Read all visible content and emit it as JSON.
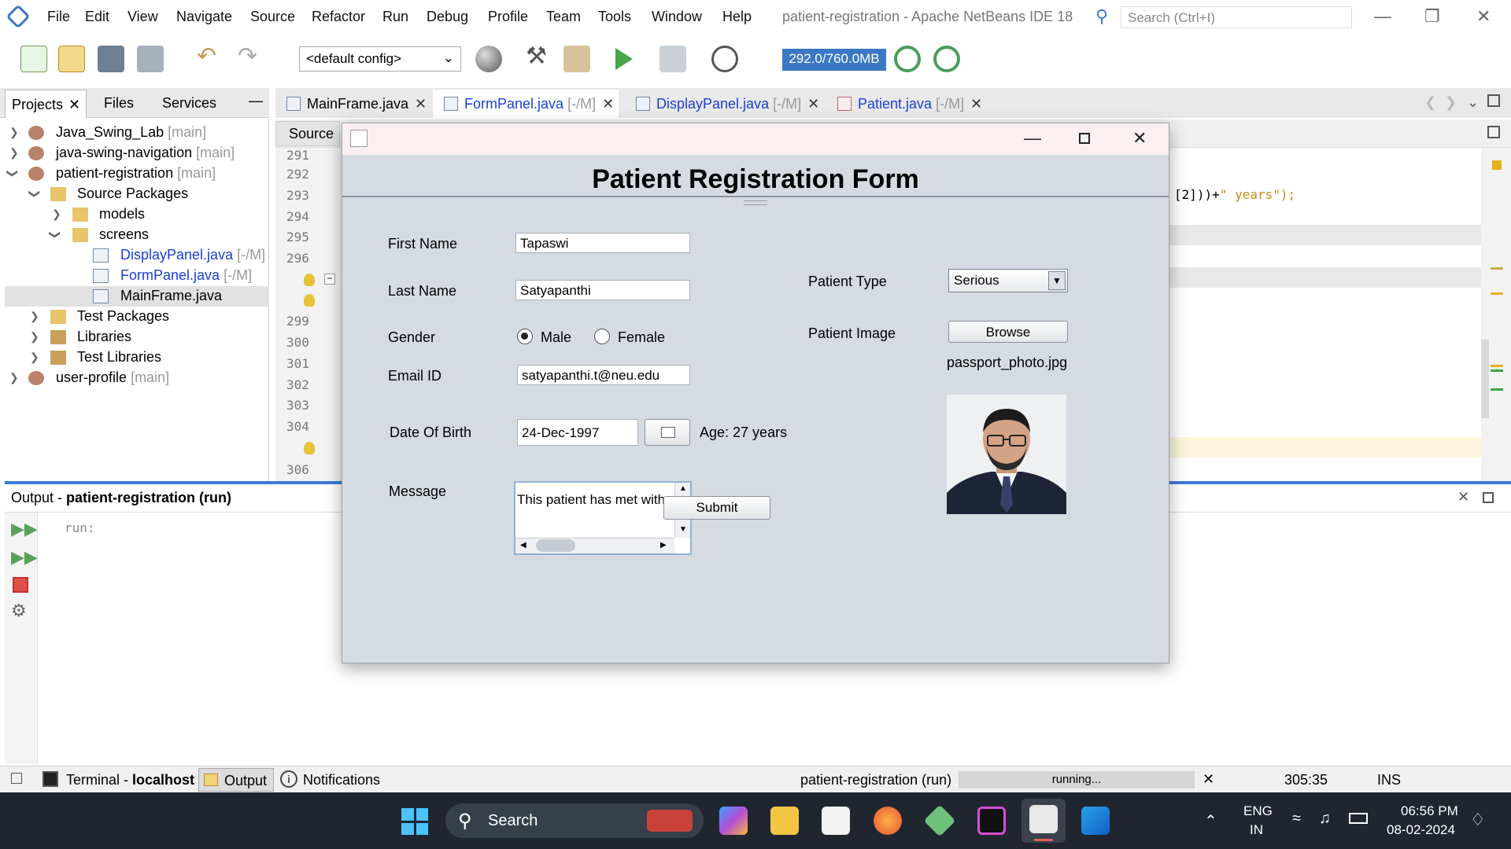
{
  "menubar": {
    "items": [
      "File",
      "Edit",
      "View",
      "Navigate",
      "Source",
      "Refactor",
      "Run",
      "Debug",
      "Profile",
      "Team",
      "Tools",
      "Window",
      "Help"
    ],
    "title": "patient-registration - Apache NetBeans IDE 18",
    "search_placeholder": "Search (Ctrl+I)"
  },
  "toolbar": {
    "config": "<default config>",
    "memory": "292.0/760.0MB"
  },
  "left_panel": {
    "tabs": [
      "Projects",
      "Files",
      "Services"
    ],
    "tree": [
      {
        "label": "Java_Swing_Lab",
        "suffix": "[main]"
      },
      {
        "label": "java-swing-navigation",
        "suffix": "[main]"
      },
      {
        "label": "patient-registration",
        "suffix": "[main]"
      },
      {
        "label": "Source Packages",
        "suffix": ""
      },
      {
        "label": "models",
        "suffix": ""
      },
      {
        "label": "screens",
        "suffix": ""
      },
      {
        "label": "DisplayPanel.java",
        "suffix": "[-/M]"
      },
      {
        "label": "FormPanel.java",
        "suffix": "[-/M]"
      },
      {
        "label": "MainFrame.java",
        "suffix": ""
      },
      {
        "label": "Test Packages",
        "suffix": ""
      },
      {
        "label": "Libraries",
        "suffix": ""
      },
      {
        "label": "Test Libraries",
        "suffix": ""
      },
      {
        "label": "user-profile",
        "suffix": "[main]"
      }
    ]
  },
  "editor": {
    "tabs": [
      {
        "label": "MainFrame.java",
        "suffix": ""
      },
      {
        "label": "FormPanel.java",
        "suffix": "[-/M]"
      },
      {
        "label": "DisplayPanel.java",
        "suffix": "[-/M]"
      },
      {
        "label": "Patient.java",
        "suffix": "[-/M]"
      }
    ],
    "source_tab": "Source",
    "line_numbers": [
      "291",
      "292",
      "293",
      "294",
      "295",
      "296",
      "299",
      "300",
      "301",
      "302",
      "303",
      "304",
      "306"
    ],
    "code_fragment_1": "[2]))+",
    "code_fragment_2": "\" years\");"
  },
  "output": {
    "title_prefix": "Output - ",
    "title_bold": "patient-registration (run)",
    "text": "run:"
  },
  "statusbar": {
    "terminal": "Terminal - ",
    "terminal_host": "localhost",
    "output": "Output",
    "notifications": "Notifications",
    "task": "patient-registration (run)",
    "progress": "running...",
    "position": "305:35",
    "mode": "INS"
  },
  "taskbar": {
    "search": "Search",
    "lang1": "ENG",
    "lang2": "IN",
    "time": "06:56 PM",
    "date": "08-02-2024"
  },
  "form": {
    "title": "Patient Registration Form",
    "first_name_label": "First Name",
    "first_name_value": "Tapaswi",
    "last_name_label": "Last Name",
    "last_name_value": "Satyapanthi",
    "gender_label": "Gender",
    "gender_male": "Male",
    "gender_female": "Female",
    "email_label": "Email ID",
    "email_value": "satyapanthi.t@neu.edu",
    "dob_label": "Date Of Birth",
    "dob_value": "24-Dec-1997",
    "age_text": "Age: 27 years",
    "message_label": "Message",
    "message_value": "This patient has met with",
    "patient_type_label": "Patient Type",
    "patient_type_value": "Serious",
    "patient_image_label": "Patient Image",
    "browse_label": "Browse",
    "image_filename": "passport_photo.jpg",
    "submit_label": "Submit"
  },
  "colors": {
    "accent": "#3c7ad6",
    "dialog_bg": "#d6dbe2",
    "taskbar": "#1f2630"
  }
}
